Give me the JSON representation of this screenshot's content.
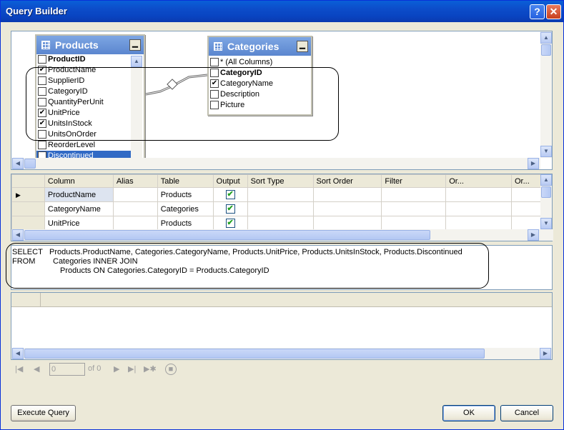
{
  "window": {
    "title": "Query Builder",
    "help_label": "?",
    "close_label": "✕"
  },
  "diagram": {
    "products": {
      "title": "Products",
      "columns": [
        {
          "label": "ProductID",
          "checked": false,
          "bold": true
        },
        {
          "label": "ProductName",
          "checked": true,
          "bold": false
        },
        {
          "label": "SupplierID",
          "checked": false,
          "bold": false
        },
        {
          "label": "CategoryID",
          "checked": false,
          "bold": false
        },
        {
          "label": "QuantityPerUnit",
          "checked": false,
          "bold": false
        },
        {
          "label": "UnitPrice",
          "checked": true,
          "bold": false
        },
        {
          "label": "UnitsInStock",
          "checked": true,
          "bold": false
        },
        {
          "label": "UnitsOnOrder",
          "checked": false,
          "bold": false
        },
        {
          "label": "ReorderLevel",
          "checked": false,
          "bold": false
        },
        {
          "label": "Discontinued",
          "checked": true,
          "bold": false
        }
      ]
    },
    "categories": {
      "title": "Categories",
      "columns": [
        {
          "label": "* (All Columns)",
          "checked": false,
          "bold": false
        },
        {
          "label": "CategoryID",
          "checked": false,
          "bold": true
        },
        {
          "label": "CategoryName",
          "checked": true,
          "bold": false
        },
        {
          "label": "Description",
          "checked": false,
          "bold": false
        },
        {
          "label": "Picture",
          "checked": false,
          "bold": false
        }
      ]
    }
  },
  "grid": {
    "headers": [
      "Column",
      "Alias",
      "Table",
      "Output",
      "Sort Type",
      "Sort Order",
      "Filter",
      "Or...",
      "Or..."
    ],
    "rows": [
      {
        "column": "ProductName",
        "alias": "",
        "table": "Products",
        "output": true,
        "current": true
      },
      {
        "column": "CategoryName",
        "alias": "",
        "table": "Categories",
        "output": true,
        "current": false
      },
      {
        "column": "UnitPrice",
        "alias": "",
        "table": "Products",
        "output": true,
        "current": false
      }
    ]
  },
  "sql": {
    "select_kw": "SELECT",
    "select_text": "Products.ProductName, Categories.CategoryName, Products.UnitPrice, Products.UnitsInStock, Products.Discontinued",
    "from_kw": "FROM",
    "from_line1": "Categories INNER JOIN",
    "from_line2": "Products ON Categories.CategoryID = Products.CategoryID"
  },
  "navigator": {
    "position": "0",
    "of_label": "of 0"
  },
  "buttons": {
    "execute": "Execute Query",
    "ok": "OK",
    "cancel": "Cancel"
  }
}
